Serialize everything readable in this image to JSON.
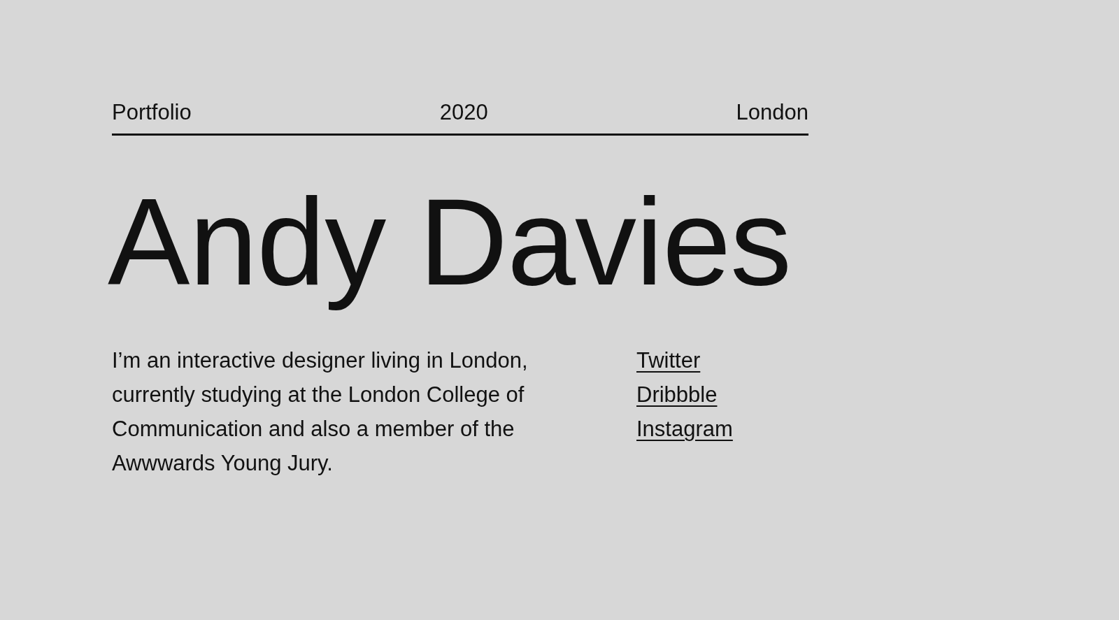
{
  "header": {
    "left": "Portfolio",
    "center": "2020",
    "right": "London"
  },
  "name": "Andy Davies",
  "bio_lines": [
    "I’m an interactive designer living in London,",
    "currently studying at the London College of",
    "Communication and also a member of the",
    "Awwwards Young Jury."
  ],
  "links": [
    "Twitter",
    "Dribbble",
    "Instagram"
  ]
}
